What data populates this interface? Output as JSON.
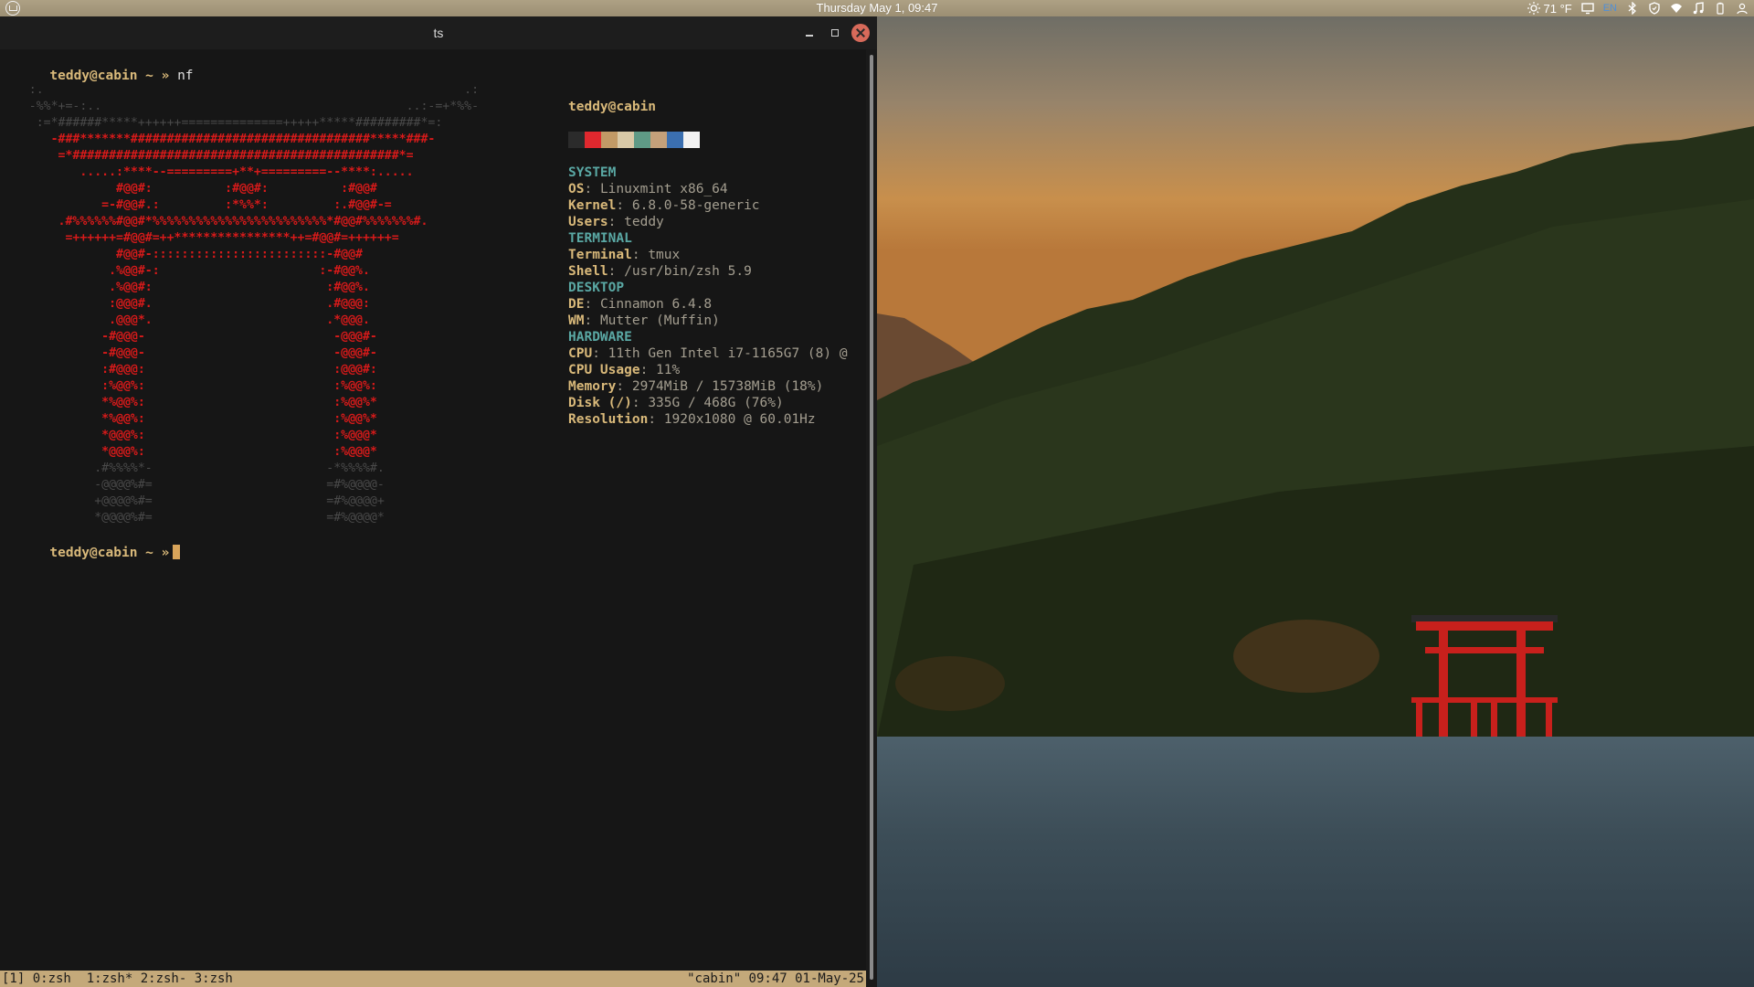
{
  "panel": {
    "clock": "Thursday May 1, 09:47",
    "weather_temp": "71 °F",
    "lang": "EN",
    "icons": [
      "menu-icon",
      "weather-icon",
      "display-icon",
      "language-icon",
      "bluetooth-icon",
      "shield-icon",
      "wifi-icon",
      "music-icon",
      "battery-icon",
      "user-icon"
    ]
  },
  "window": {
    "title": "ts"
  },
  "terminal": {
    "prompt": "teddy@cabin ~ »",
    "command": "nf",
    "prompt2": "teddy@cabin ~ »"
  },
  "fetch": {
    "user": "teddy@cabin",
    "palette": [
      "#2b2b2b",
      "#e0282e",
      "#c29a66",
      "#d9c9a7",
      "#5f9a86",
      "#c4a07a",
      "#3b6fb0",
      "#f2f2f2"
    ],
    "lines": [
      {
        "type": "section",
        "text": "SYSTEM"
      },
      {
        "type": "kv",
        "key": "OS",
        "value": "Linuxmint x86_64"
      },
      {
        "type": "kv",
        "key": "Kernel",
        "value": "6.8.0-58-generic"
      },
      {
        "type": "kv",
        "key": "Users",
        "value": "teddy"
      },
      {
        "type": "section",
        "text": "TERMINAL"
      },
      {
        "type": "kv",
        "key": "Terminal",
        "value": "tmux"
      },
      {
        "type": "kv",
        "key": "Shell",
        "value": "/usr/bin/zsh 5.9"
      },
      {
        "type": "section",
        "text": "DESKTOP"
      },
      {
        "type": "kv",
        "key": "DE",
        "value": "Cinnamon 6.4.8"
      },
      {
        "type": "kv",
        "key": "WM",
        "value": "Mutter (Muffin)"
      },
      {
        "type": "section",
        "text": "HARDWARE"
      },
      {
        "type": "kv",
        "key": "CPU",
        "value": "11th Gen Intel i7-1165G7 (8) @"
      },
      {
        "type": "kv",
        "key": "CPU Usage",
        "value": "11%"
      },
      {
        "type": "kv",
        "key": "Memory",
        "value": "2974MiB / 15738MiB (18%)"
      },
      {
        "type": "kv",
        "key": "Disk (/)",
        "value": "335G / 468G (76%)"
      },
      {
        "type": "kv",
        "key": "Resolution",
        "value": "1920x1080 @ 60.01Hz"
      }
    ]
  },
  "ascii_art": [
    "    :.                                                          .:",
    "    -%%*+=-:..                                          ..:-=+*%%-",
    "     :=*######*****++++++==============+++++*****#########*=:",
    "       -###*******#################################*****###-",
    "        =*#############################################*=",
    "           .....:****--=========+**+=========--****:.....",
    "                #@@#:          :#@@#:          :#@@#",
    "              =-#@@#.:         :*%%*:         :.#@@#-=",
    "        .#%%%%%%#@@#*%%%%%%%%%%%%%%%%%%%%%%%%*#@@#%%%%%%%#.",
    "         =++++++=#@@#=++****************++=#@@#=++++++=",
    "                #@@#-::::::::::::::::::::::::-#@@#",
    "               .%@@#-:                      :-#@@%.",
    "               .%@@#:                        :#@@%.",
    "               :@@@#.                        .#@@@:",
    "               .@@@*.                        .*@@@.",
    "              -#@@@-                          -@@@#-",
    "              -#@@@-                          -@@@#-",
    "              :#@@@:                          :@@@#:",
    "              :%@@%:                          :%@@%:",
    "              *%@@%:                          :%@@%*",
    "              *%@@%:                          :%@@%*",
    "              *@@@%:                          :%@@@*",
    "              *@@@%:                          :%@@@*",
    "             .#%%%%*-                        -*%%%%#.",
    "             -@@@@%#=                        =#%@@@@-",
    "             +@@@@%#=                        =#%@@@@+",
    "             *@@@@%#=                        =#%@@@@*"
  ],
  "tmux": {
    "left": "[1] 0:zsh  1:zsh* 2:zsh- 3:zsh",
    "right": "\"cabin\" 09:47 01-May-25"
  }
}
